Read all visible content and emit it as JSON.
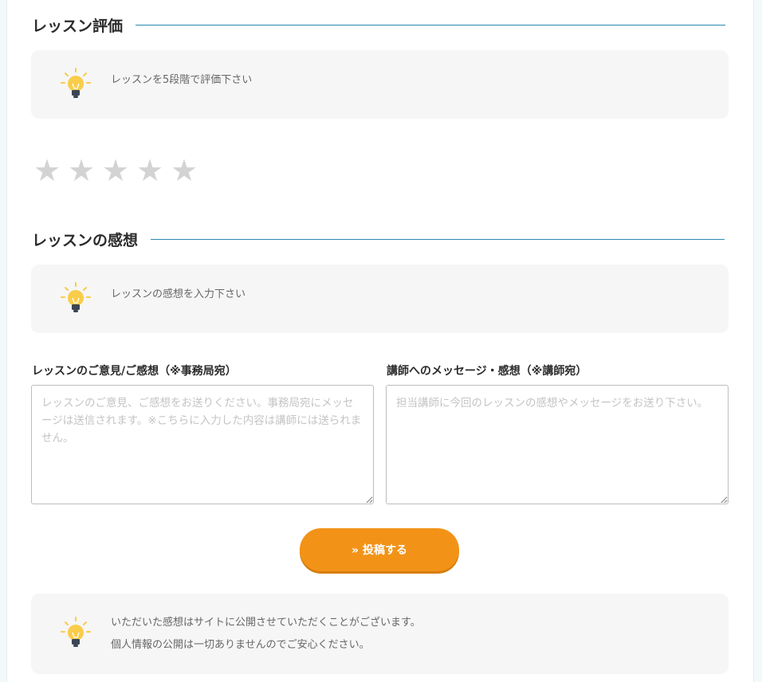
{
  "rating_section": {
    "title": "レッスン評価",
    "tip": "レッスンを5段階で評価下さい",
    "stars": [
      "★",
      "★",
      "★",
      "★",
      "★"
    ],
    "rating_value": 0,
    "rating_max": 5
  },
  "impression_section": {
    "title": "レッスンの感想",
    "tip": "レッスンの感想を入力下さい"
  },
  "form": {
    "office_label": "レッスンのご意見/ご感想（※事務局宛）",
    "office_placeholder": "レッスンのご意見、ご感想をお送りください。事務局宛にメッセージは送信されます。※こちらに入力した内容は講師には送られません。",
    "office_value": "",
    "teacher_label": "講師へのメッセージ・感想（※講師宛）",
    "teacher_placeholder": "担当講師に今回のレッスンの感想やメッセージをお送り下さい。",
    "teacher_value": "",
    "submit_label": "» 投稿する"
  },
  "notice": {
    "line1": "いただいた感想はサイトに公開させていただくことがございます。",
    "line2": "個人情報の公開は一切ありませんのでご安心ください。"
  },
  "colors": {
    "accent_line": "#2a8ab0",
    "button": "#f29318",
    "star_empty": "#d3d3d3",
    "bulb": "#f9cc4a"
  },
  "icons": {
    "tip": "lightbulb-icon",
    "star": "star-icon"
  }
}
